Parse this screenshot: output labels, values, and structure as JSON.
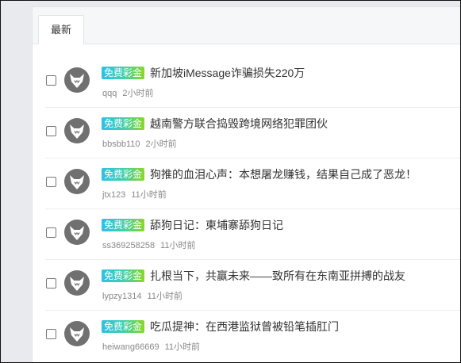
{
  "tabs": [
    {
      "label": "最新"
    }
  ],
  "badge_label": "免费彩金",
  "threads": [
    {
      "title": "新加坡iMessage诈骗损失220万",
      "author": "qqq",
      "time": "2小时前"
    },
    {
      "title": "越南警方联合捣毁跨境网络犯罪团伙",
      "author": "bbsbb110",
      "time": "2小时前"
    },
    {
      "title": "狗推的血泪心声：本想屠龙赚钱，结果自己成了恶龙！",
      "author": "jtx123",
      "time": "11小时前"
    },
    {
      "title": "舔狗日记：柬埔寨舔狗日记",
      "author": "ss369258258",
      "time": "11小时前"
    },
    {
      "title": "扎根当下，共赢未来——致所有在东南亚拼搏的战友",
      "author": "lypzy1314",
      "time": "11小时前"
    },
    {
      "title": "吃瓜提神：在西港监狱曾被铅笔插肛门",
      "author": "heiwang66669",
      "time": "11小时前"
    }
  ]
}
